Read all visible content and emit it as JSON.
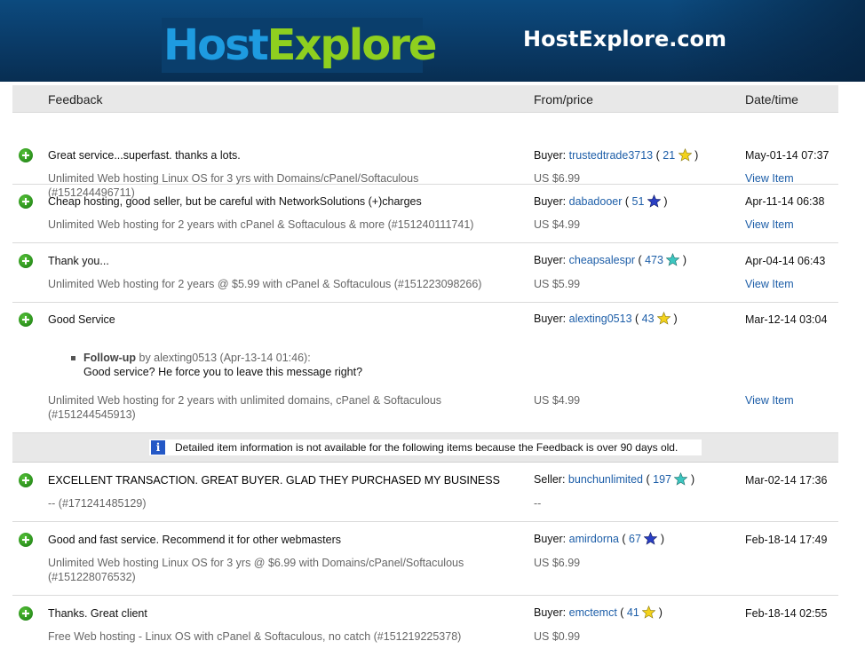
{
  "banner": {
    "logo_part1": "Host",
    "logo_part2": "Explore",
    "site_name": "HostExplore.com"
  },
  "table": {
    "headers": {
      "feedback": "Feedback",
      "from": "From/price",
      "date": "Date/time"
    },
    "rows": [
      {
        "comment": "Great service...superfast. thanks a lots.",
        "item_line1": "Unlimited Web hosting Linux OS for 3 yrs with Domains/cPanel/Softaculous",
        "item_line2": "(#151244496711)",
        "role": "Buyer:",
        "user": "trustedtrade3713",
        "score": "21",
        "star_color": "#f3d21b",
        "price": "US $6.99",
        "date": "May-01-14 07:37",
        "view": "View Item"
      },
      {
        "comment": "Cheap hosting, good seller, but be careful with NetworkSolutions (+)charges",
        "item_line1": "Unlimited Web hosting for 2 years with cPanel & Softaculous & more (#151240111741)",
        "role": "Buyer:",
        "user": "dabadooer",
        "score": "51",
        "star_color": "#2a3fc4",
        "price": "US $4.99",
        "date": "Apr-11-14 06:38",
        "view": "View Item"
      },
      {
        "comment": "Thank you...",
        "item_line1": "Unlimited Web hosting for 2 years @ $5.99 with cPanel & Softaculous (#151223098266)",
        "role": "Buyer:",
        "user": "cheapsalespr",
        "score": "473",
        "star_color": "#3cc6c0",
        "price": "US $5.99",
        "date": "Apr-04-14 06:43",
        "view": "View Item"
      },
      {
        "comment": "Good Service",
        "followup_label": "Follow-up",
        "followup_by": "by alexting0513 (Apr-13-14 01:46):",
        "followup_text": "Good service? He force you to leave this message right?",
        "item_line1": "Unlimited Web hosting for 2 years with unlimited domains, cPanel & Softaculous",
        "item_line2": "(#151244545913)",
        "role": "Buyer:",
        "user": "alexting0513",
        "score": "43",
        "star_color": "#f3d21b",
        "price": "US $4.99",
        "date": "Mar-12-14 03:04",
        "view": "View Item"
      },
      {
        "comment": "EXCELLENT TRANSACTION. GREAT BUYER. GLAD THEY PURCHASED MY BUSINESS",
        "item_line1": "-- (#171241485129)",
        "role": "Seller:",
        "user": "bunchunlimited",
        "score": "197",
        "star_color": "#3cc6c0",
        "price": "--",
        "date": "Mar-02-14 17:36"
      },
      {
        "comment": "Good and fast service. Recommend it for other webmasters",
        "item_line1": "Unlimited Web hosting Linux OS for 3 yrs @ $6.99 with Domains/cPanel/Softaculous",
        "item_line2": "(#151228076532)",
        "role": "Buyer:",
        "user": "amirdorna",
        "score": "67",
        "star_color": "#2a3fc4",
        "price": "US $6.99",
        "date": "Feb-18-14 17:49"
      },
      {
        "comment": "Thanks. Great client",
        "item_line1": "Free Web hosting - Linux OS with cPanel & Softaculous, no catch (#151219225378)",
        "role": "Buyer:",
        "user": "emctemct",
        "score": "41",
        "star_color": "#f3d21b",
        "price": "US $0.99",
        "date": "Feb-18-14 02:55"
      }
    ],
    "notice": "Detailed item information is not available for the following items because the Feedback is over 90 days old."
  },
  "icons": {
    "positive": "plus-circle-icon",
    "star": "star-icon",
    "info": "info-icon"
  }
}
